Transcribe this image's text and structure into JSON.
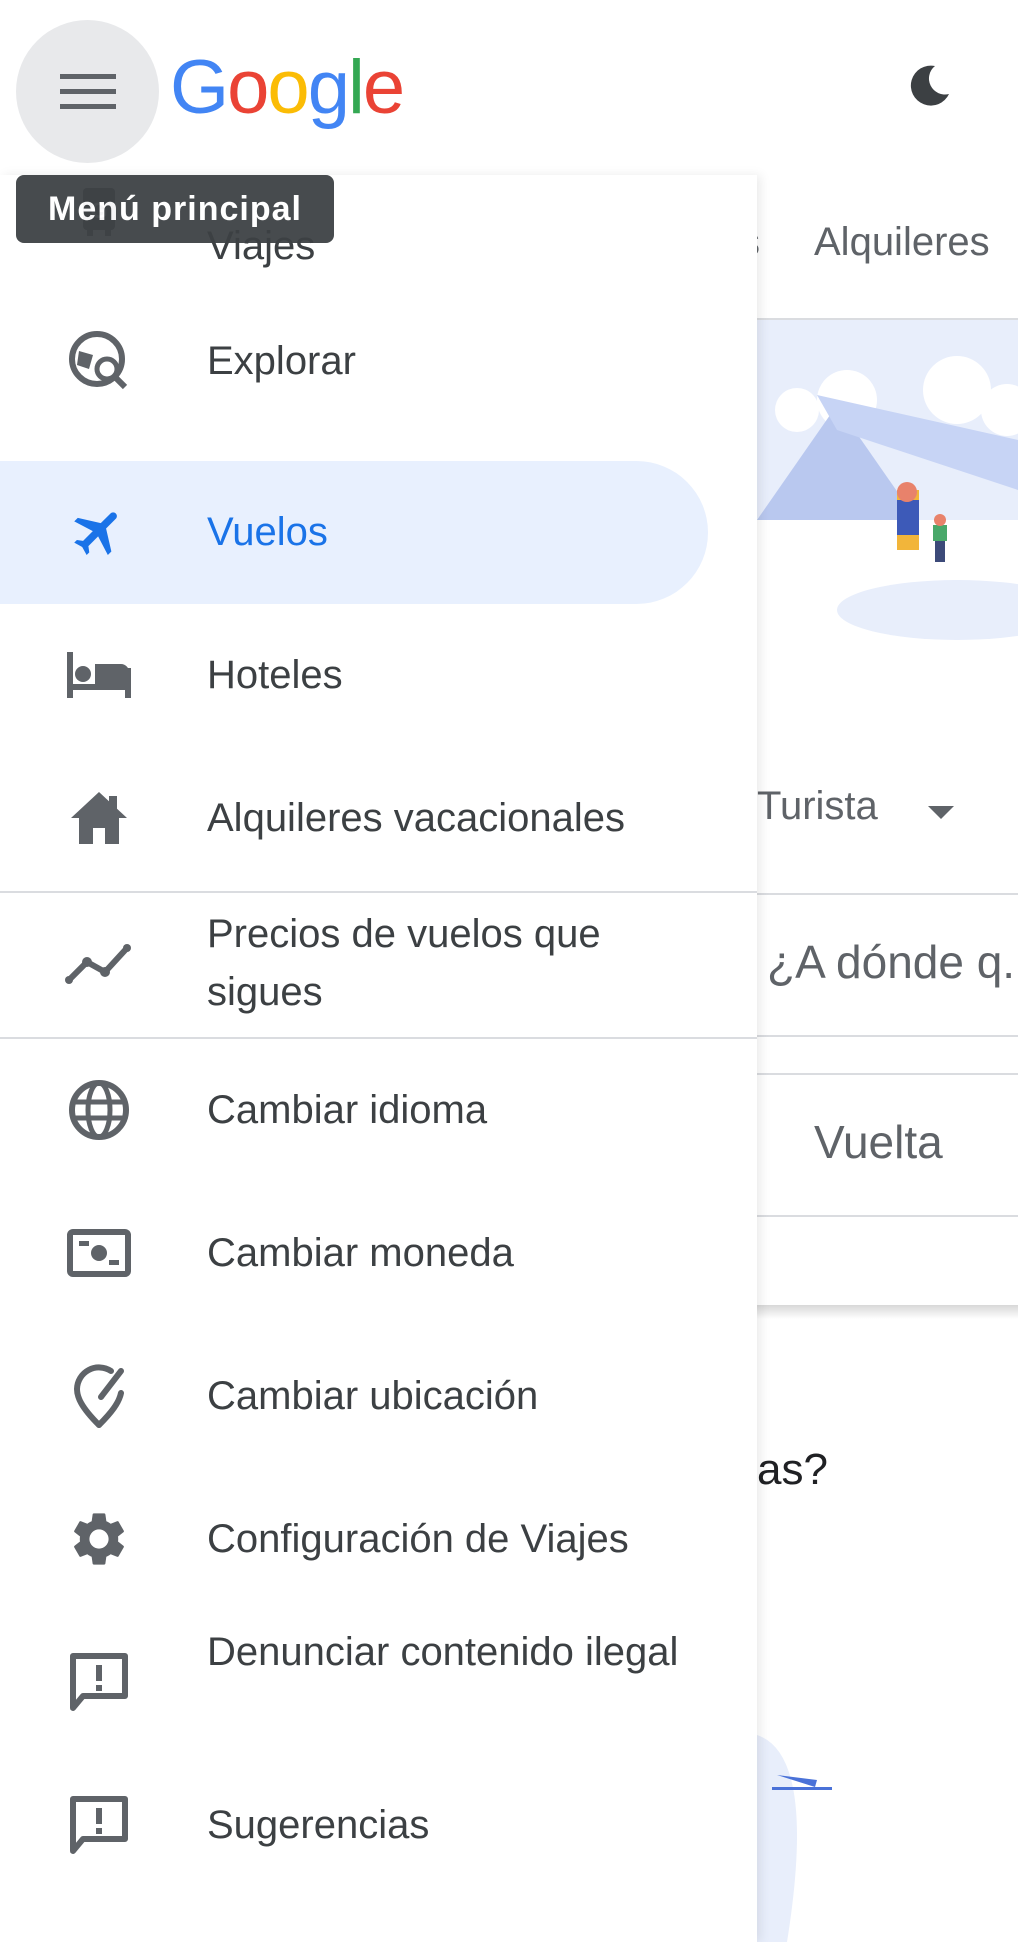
{
  "header": {
    "menu_tooltip": "Menú principal",
    "logo": [
      "G",
      "o",
      "o",
      "g",
      "l",
      "e"
    ],
    "logo_colors": [
      "#4285f4",
      "#ea4335",
      "#fbbc05",
      "#4285f4",
      "#34a853",
      "#ea4335"
    ]
  },
  "background": {
    "tab_partial": "s",
    "tab_rentals": "Alquileres",
    "cabin_select": "Turista",
    "destination_placeholder": "¿A dónde q...",
    "return_field": "Vuelta",
    "question_partial": "as?"
  },
  "drawer": {
    "items": [
      {
        "label": "Viajes",
        "icon": "travel-bag-icon"
      },
      {
        "label": "Explorar",
        "icon": "explore-globe-icon"
      },
      {
        "label": "Vuelos",
        "icon": "airplane-icon",
        "active": true
      },
      {
        "label": "Hoteles",
        "icon": "bed-icon"
      },
      {
        "label": "Alquileres vacacionales",
        "icon": "house-icon"
      },
      {
        "label": "Precios de vuelos que sigues",
        "icon": "trending-line-icon"
      },
      {
        "label": "Cambiar idioma",
        "icon": "globe-icon"
      },
      {
        "label": "Cambiar moneda",
        "icon": "banknote-icon"
      },
      {
        "label": "Cambiar ubicación",
        "icon": "location-edit-icon"
      },
      {
        "label": "Configuración de Viajes",
        "icon": "gear-icon"
      },
      {
        "label": "Denunciar contenido ilegal",
        "icon": "report-icon"
      },
      {
        "label": "Sugerencias",
        "icon": "feedback-icon"
      }
    ]
  },
  "colors": {
    "accent": "#1a73e8",
    "active_bg": "#e8f0fe",
    "text": "#3c4043",
    "icon": "#5f6368"
  }
}
